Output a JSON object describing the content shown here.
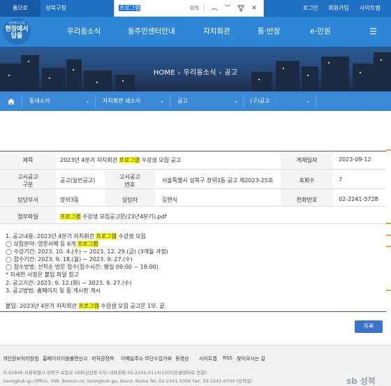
{
  "topbar": {
    "home": "홈으로",
    "district": "성북구청",
    "login": "로그인",
    "signup": "회원가입",
    "sitemap": "사이트맵"
  },
  "findbar": {
    "query": "프로그램",
    "count": "0/5",
    "up_icon": "chevron-up-icon",
    "down_icon": "chevron-down-icon",
    "filter_icon": "filter-icon",
    "close_icon": "close-icon"
  },
  "logo": {
    "text": "현장에서 답을",
    "small": "현장에서 답을"
  },
  "nav": {
    "items": [
      "우리동소식",
      "동주민센터안내",
      "자치회관",
      "통·반장",
      "e-민원"
    ],
    "menu_icon": "menu-icon"
  },
  "banner": {
    "home": "HOME",
    "section": "우리동소식",
    "page": "공고",
    "sep": "›"
  },
  "subnav": {
    "home_icon": "home-icon",
    "items": [
      "동네소식",
      "자치회관 새소식",
      "공고",
      "(구)공고"
    ]
  },
  "board": {
    "title_label": "제목",
    "title_pre": "2023년 4분기 자치회관 ",
    "title_hl": "프로그램",
    "title_post": " 수강생 모집 공고",
    "date_label": "게재일자",
    "date_value": "2023-09-12",
    "type_label_1": "고시공고",
    "type_label_2": "구분",
    "type_value": "공고(일반공고)",
    "num_label_1": "고시공고",
    "num_label_2": "번호",
    "num_value": "서울특별시 성북구 장위3동 공고 제2023-25호",
    "views_label": "조회수",
    "views_value": "7",
    "dept_label": "담당부서",
    "dept_value": "장위3동",
    "person_label": "담당자",
    "person_value": "김현식",
    "phone_label": "전화번호",
    "phone_value": "02-2241-5728",
    "attach_label": "첨부파일",
    "attach_hl": "프로그램",
    "attach_post": " 수강생 모집공고문(23년4분기).pdf"
  },
  "content": {
    "l1_pre": "1. 공고내용: 2023년 4분기 자치회관 ",
    "l1_hl": "프로그램",
    "l1_post": " 수강생 모집",
    "l2_pre": "◯ 모집분야: 영문서예 등 6개 ",
    "l2_hl": "프로그램",
    "l3": "◯ 수강기간: 2023. 10. 4.(수) ~ 2023. 12. 29.(금) (3개월 과정)",
    "l4": "◯ 접수기간: 2023. 9. 18.(월) ~ 2023. 9. 27.(수)",
    "l5": "◯ 접수방법: 선착순 방문 접수(접수시간: 평일 09:00 ~ 18:00)",
    "l6": "* 자세한 사항은 붙임 파일 참고",
    "l7": "2. 공고기간: 2023. 9. 12.(화) ~ 2023. 9. 27.(수)",
    "l8": "3. 공고방법: 홈페이지 및 동 게시판 게시",
    "l9_pre": "붙임: 2023년 4분기 자치회관 ",
    "l9_hl": "프로그램",
    "l9_post": " 수강생 모집 공고문 1부. 끝."
  },
  "list_button": "목록",
  "footer": {
    "links": [
      "개인정보처리방침",
      "홈페이지이용불편신고",
      "저작권정책",
      "이메일주소 무단수집거부",
      "동영상",
      "사이트맵",
      "RSS",
      "찾아오시는 길"
    ],
    "addr1": "우.02848 서울특별시 성북구 보문로 168(삼선동 5가) 대표전화 02-2241-3114(120다산콜센터로 연결)",
    "addr2": "Seongbuk-gu Office, 168, Bomun-ro, Seongbuk-gu, Seoul, Korea Tel. 02-2241-3300 Fax. 02-2241-6700 (당직실)",
    "logo": "sb 성북"
  }
}
